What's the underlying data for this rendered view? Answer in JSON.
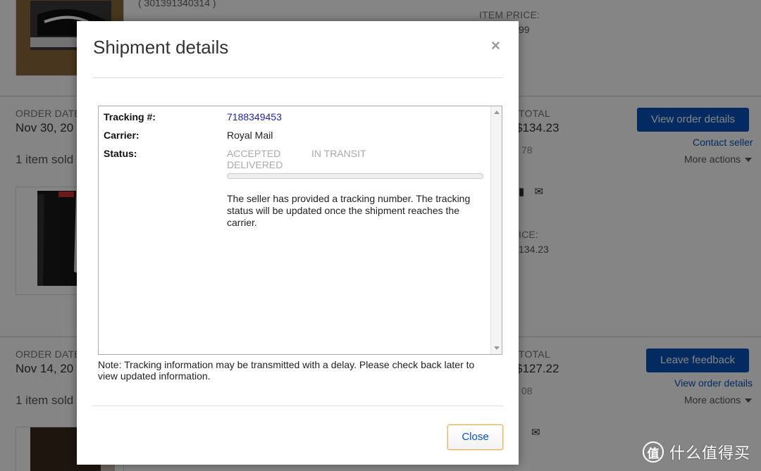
{
  "background": {
    "top_item": {
      "item_id": "( 301391340314 )",
      "item_price_label": "ITEM PRICE:",
      "item_price_partial": "99"
    },
    "orders": [
      {
        "order_date_label": "ORDER DATE",
        "order_date": "Nov 30, 20",
        "sold": "1 item sold",
        "total_label": "TOTAL",
        "total": "$134.23",
        "sub_partial": "78",
        "item_price_label_partial": "ICE:",
        "item_price_partial": "134.23",
        "primary_button": "View order details",
        "link": "Contact seller",
        "more_actions": "More actions"
      },
      {
        "order_date_label": "ORDER DATE",
        "order_date": "Nov 14, 20",
        "sold": "1 item sold",
        "total_label": "TOTAL",
        "total": "$127.22",
        "sub_partial": "08",
        "primary_button": "Leave feedback",
        "link": "View order details",
        "more_actions": "More actions"
      }
    ]
  },
  "modal": {
    "title": "Shipment details",
    "close_x": "×",
    "tracking_label": "Tracking #:",
    "tracking_number": "7188349453",
    "carrier_label": "Carrier:",
    "carrier": "Royal Mail",
    "status_label": "Status:",
    "steps": [
      "ACCEPTED",
      "IN TRANSIT",
      "DELIVERED"
    ],
    "progress": 0,
    "message": "The seller has provided a tracking number. The tracking status will be updated once the shipment reaches the carrier.",
    "note": "Note: Tracking information may be transmitted with a delay. Please check back later to view updated information.",
    "close_button": "Close"
  },
  "watermark": {
    "symbol": "值",
    "text": "什么值得买"
  },
  "colors": {
    "primary": "#0654ba",
    "link": "#2222aa",
    "overlay": "rgba(0,0,0,0.48)"
  }
}
